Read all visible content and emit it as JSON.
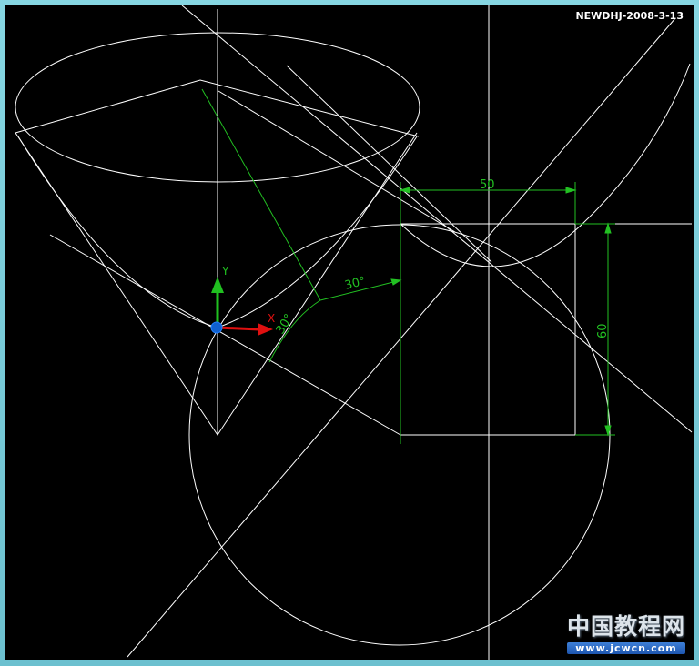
{
  "stamp": "NEWDHJ-2008-3-13",
  "dimensions": {
    "width_label": "50",
    "height_label": "60",
    "angle_label_1": "30°",
    "angle_label_2": "30°"
  },
  "ucs": {
    "y_label": "Y",
    "x_label": "X"
  },
  "watermark": {
    "chinese": "中国教程网",
    "url": "www.jcwcn.com"
  },
  "colors": {
    "background": "#000000",
    "geometry": "#ffffff",
    "dimension": "#22c022",
    "axis_x": "#e01010",
    "axis_y": "#20c020",
    "ucs_origin": "#1060d0"
  }
}
